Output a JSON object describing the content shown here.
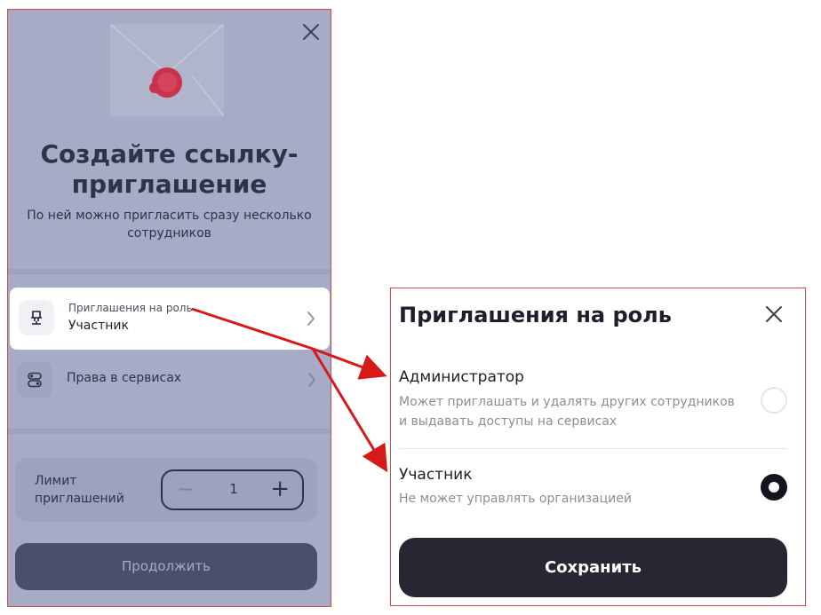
{
  "left_screen": {
    "hero_title": "Создайте ссылку-приглашение",
    "hero_subtitle": "По ней можно пригласить сразу несколько сотрудников",
    "role_row": {
      "caption": "Приглашения на роль",
      "value": "Участник"
    },
    "services_row": {
      "label": "Права в сервисах"
    },
    "limit": {
      "label": "Лимит приглашений",
      "value": "1",
      "minus": "−",
      "plus": "+"
    },
    "continue_label": "Продолжить",
    "colors": {
      "overlay": "#a6abc6",
      "button": "#4a4f6b"
    },
    "icons": [
      "close-icon",
      "envelope-illustration",
      "chair-icon",
      "toggle-icon",
      "chevron-right-icon"
    ]
  },
  "role_dialog": {
    "title": "Приглашения на роль",
    "options": [
      {
        "name": "Администратор",
        "description": "Может приглашать и удалять других сотрудников и выдавать доступы на сервисах",
        "selected": false
      },
      {
        "name": "Участник",
        "description": "Не может управлять организацией",
        "selected": true
      }
    ],
    "save_label": "Сохранить",
    "colors": {
      "accent": "#262732",
      "annotation": "#d61a1a"
    }
  }
}
